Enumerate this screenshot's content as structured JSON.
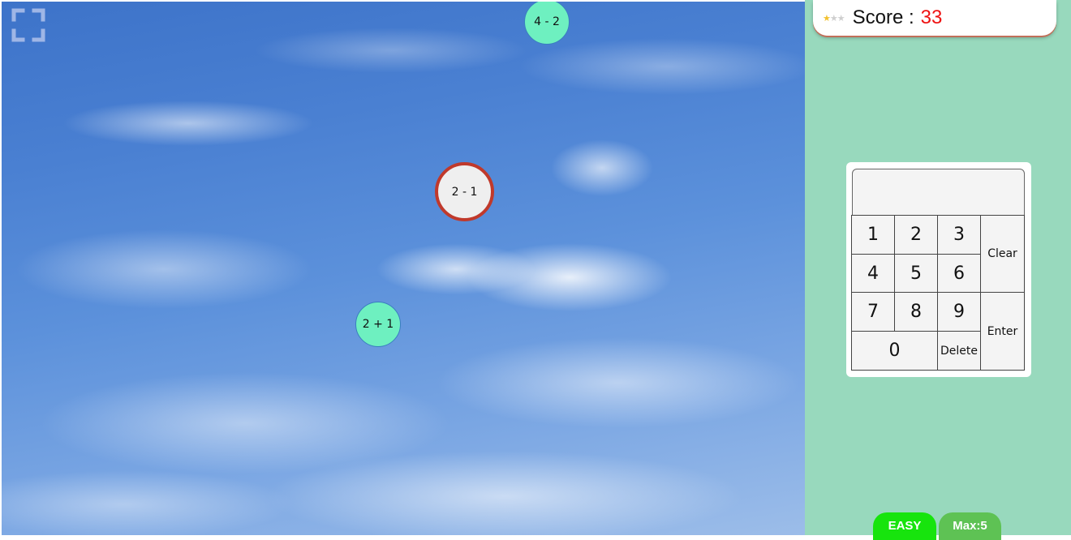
{
  "game": {
    "bubbles": [
      {
        "id": "bubble-top",
        "expression": "4 - 2",
        "style": "normal"
      },
      {
        "id": "bubble-target",
        "expression": "2 - 1",
        "style": "target"
      },
      {
        "id": "bubble-low",
        "expression": "2 + 1",
        "style": "normal"
      }
    ],
    "fullscreen_icon": "fullscreen-icon"
  },
  "score": {
    "label": "Score :",
    "value": "33",
    "stars_filled": 1,
    "stars_total": 3
  },
  "keypad": {
    "display_value": "",
    "keys": {
      "k1": "1",
      "k2": "2",
      "k3": "3",
      "k4": "4",
      "k5": "5",
      "k6": "6",
      "k7": "7",
      "k8": "8",
      "k9": "9",
      "k0": "0",
      "clear": "Clear",
      "enter": "Enter",
      "delete": "Delete"
    }
  },
  "footer": {
    "level": "EASY",
    "max": "Max:5"
  },
  "colors": {
    "panel_bg": "#98d9bd",
    "bubble_fill": "#6ef0c0",
    "target_border": "#c0392b",
    "score_value": "#ee1111",
    "level_pill": "#17e40d",
    "max_pill": "#5ec254"
  }
}
